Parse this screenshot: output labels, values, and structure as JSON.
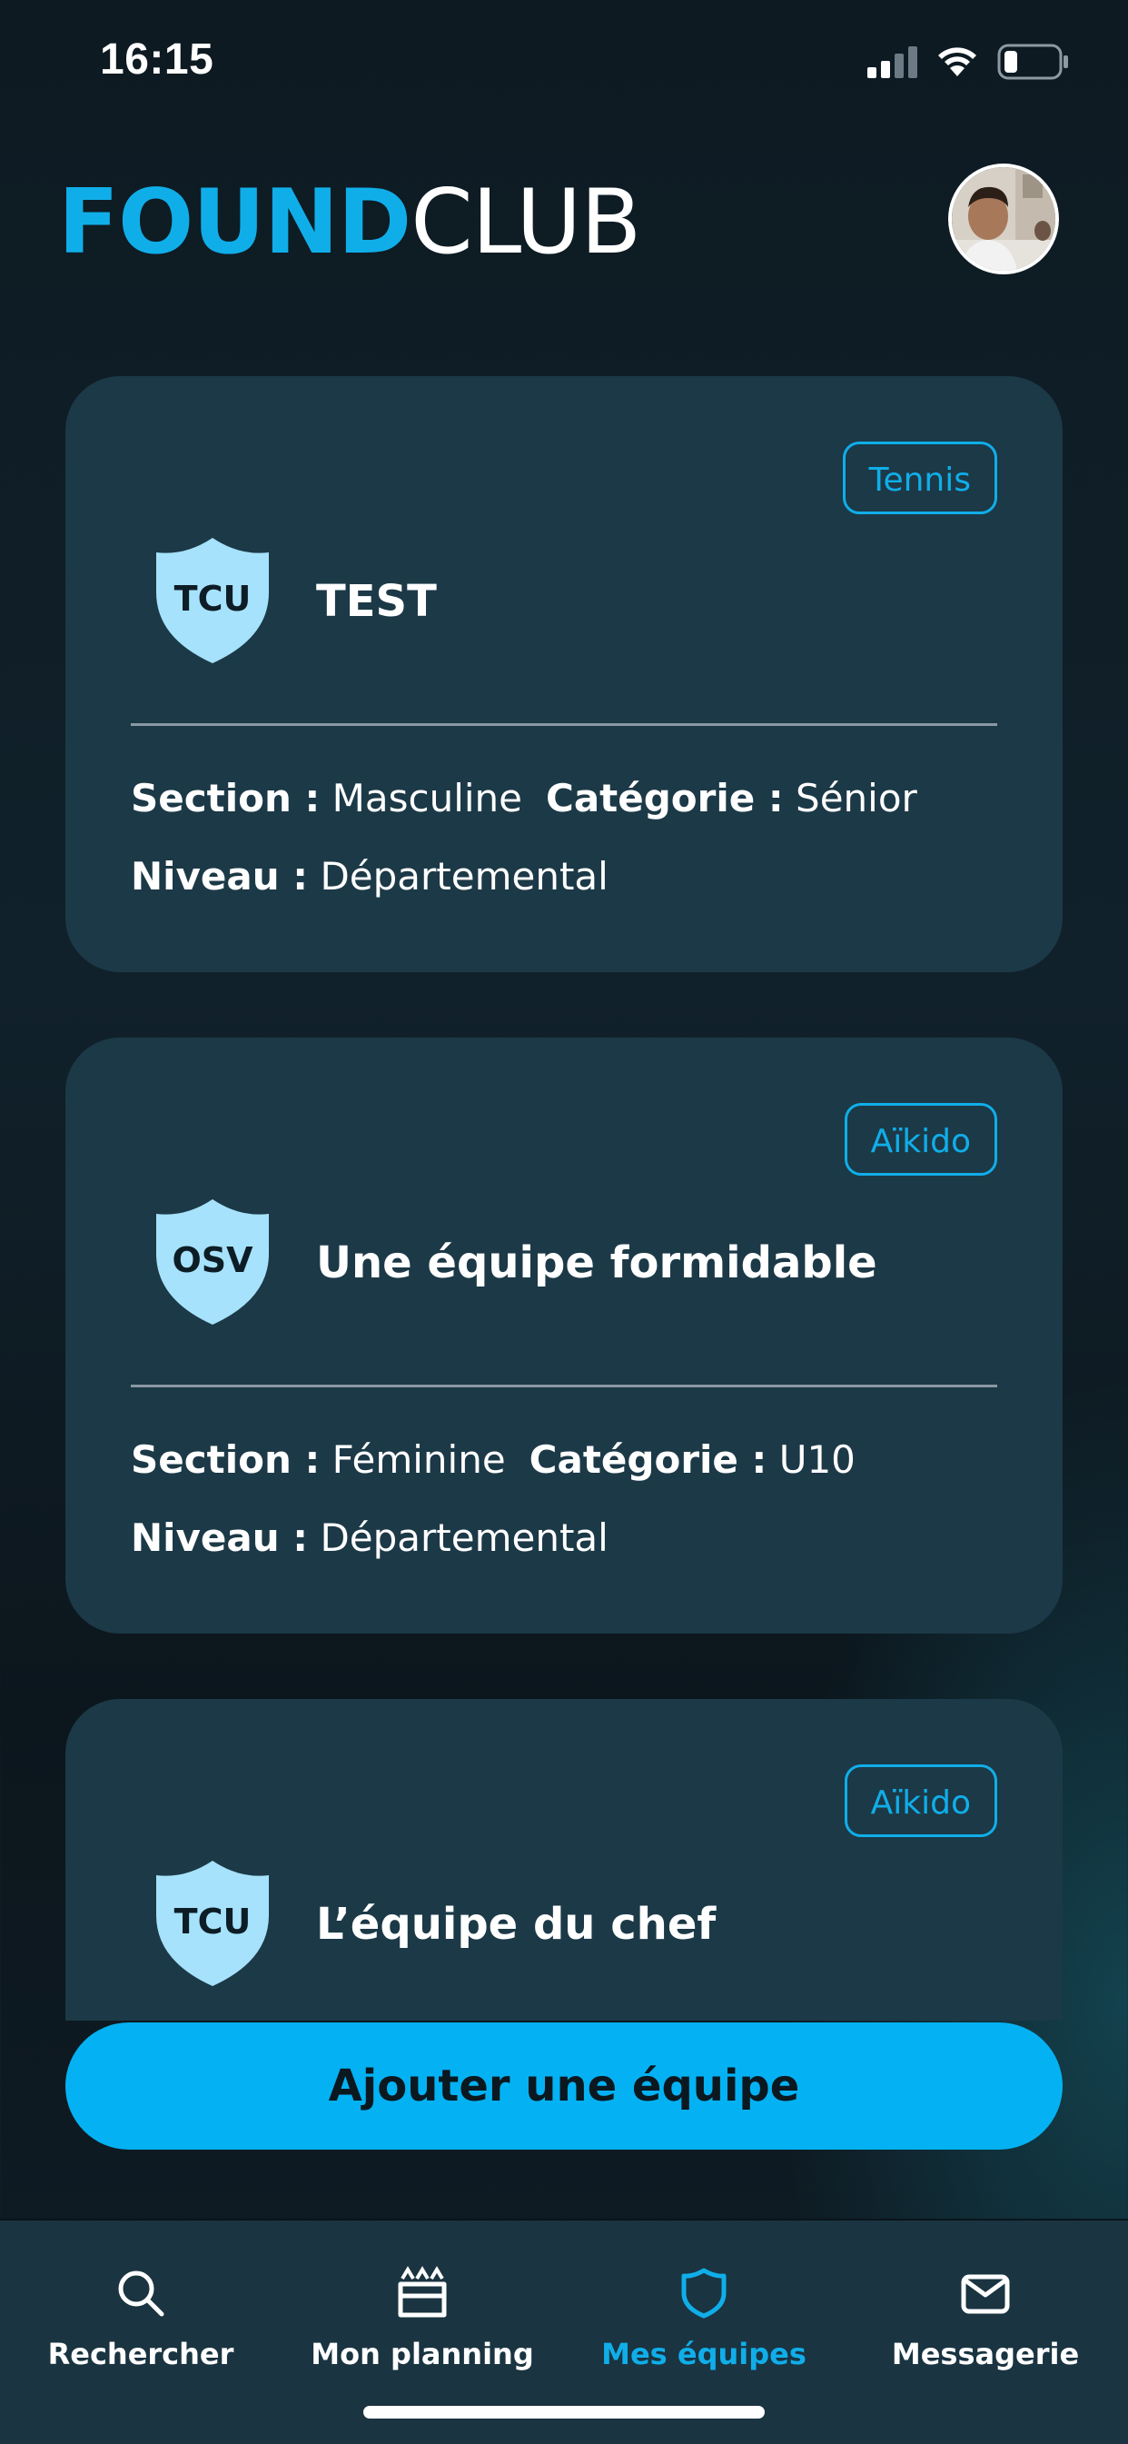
{
  "status": {
    "time": "16:15"
  },
  "brand": {
    "part1": "FOUND",
    "part2": "CLUB"
  },
  "colors": {
    "accent": "#10aee9",
    "card": "#1c3947",
    "button": "#04b2f3",
    "tabbar": "#1a3441"
  },
  "cards": [
    {
      "badge": "Tennis",
      "crest": "TCU",
      "name": "TEST",
      "section_label": "Section :",
      "section": "Masculine",
      "category_label": "Catégorie :",
      "category": "Sénior",
      "level_label": "Niveau :",
      "level": "Départemental"
    },
    {
      "badge": "Aïkido",
      "crest": "OSV",
      "name": "Une équipe formidable",
      "section_label": "Section :",
      "section": "Féminine",
      "category_label": "Catégorie :",
      "category": "U10",
      "level_label": "Niveau :",
      "level": "Départemental"
    },
    {
      "badge": "Aïkido",
      "crest": "TCU",
      "name": "L’équipe du chef"
    }
  ],
  "add_button": "Ajouter une équipe",
  "tabs": [
    {
      "label": "Rechercher",
      "icon": "search-icon"
    },
    {
      "label": "Mon planning",
      "icon": "calendar-icon"
    },
    {
      "label": "Mes équipes",
      "icon": "shield-icon",
      "active": true
    },
    {
      "label": "Messagerie",
      "icon": "mail-icon"
    }
  ]
}
